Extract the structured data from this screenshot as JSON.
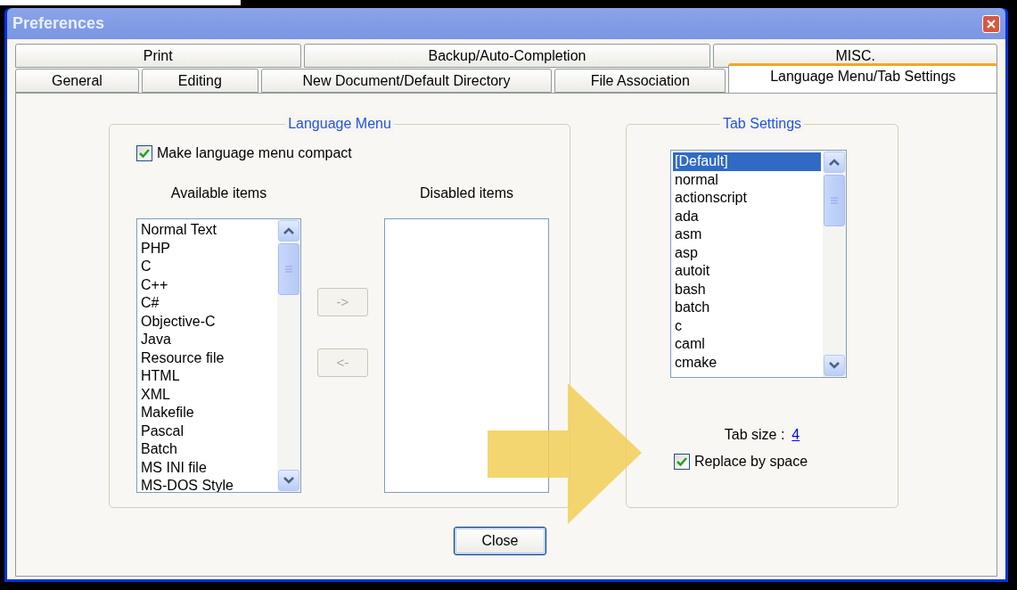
{
  "window": {
    "title": "Preferences"
  },
  "tab_rows": [
    [
      {
        "label": "Print",
        "selected": false
      },
      {
        "label": "Backup/Auto-Completion",
        "selected": false
      },
      {
        "label": "MISC.",
        "selected": false
      }
    ],
    [
      {
        "label": "General",
        "selected": false
      },
      {
        "label": "Editing",
        "selected": false
      },
      {
        "label": "New Document/Default Directory",
        "selected": false
      },
      {
        "label": "File Association",
        "selected": false
      },
      {
        "label": "Language Menu/Tab Settings",
        "selected": true
      }
    ]
  ],
  "language_menu": {
    "title": "Language Menu",
    "compact": {
      "label": "Make language menu compact",
      "checked": true
    },
    "available": {
      "heading": "Available items",
      "items": [
        "Normal Text",
        "PHP",
        "C",
        "C++",
        "C#",
        "Objective-C",
        "Java",
        "Resource file",
        "HTML",
        "XML",
        "Makefile",
        "Pascal",
        "Batch",
        "MS INI file",
        "MS-DOS Style"
      ]
    },
    "move_buttons": [
      {
        "label": "->",
        "disabled": true
      },
      {
        "label": "<-",
        "disabled": true
      }
    ],
    "disabled": {
      "heading": "Disabled items"
    }
  },
  "tab_settings": {
    "title": "Tab Settings",
    "languages": [
      {
        "label": "[Default]",
        "selected": true
      },
      {
        "label": "normal",
        "selected": false
      },
      {
        "label": "actionscript",
        "selected": false
      },
      {
        "label": "ada",
        "selected": false
      },
      {
        "label": "asm",
        "selected": false
      },
      {
        "label": "asp",
        "selected": false
      },
      {
        "label": "autoit",
        "selected": false
      },
      {
        "label": "bash",
        "selected": false
      },
      {
        "label": "batch",
        "selected": false
      },
      {
        "label": "c",
        "selected": false
      },
      {
        "label": "caml",
        "selected": false
      },
      {
        "label": "cmake",
        "selected": false
      }
    ],
    "tab_size_label": "Tab size :",
    "tab_size": "4",
    "replace": {
      "label": "Replace by space",
      "checked": true
    }
  },
  "close_button": "Close"
}
